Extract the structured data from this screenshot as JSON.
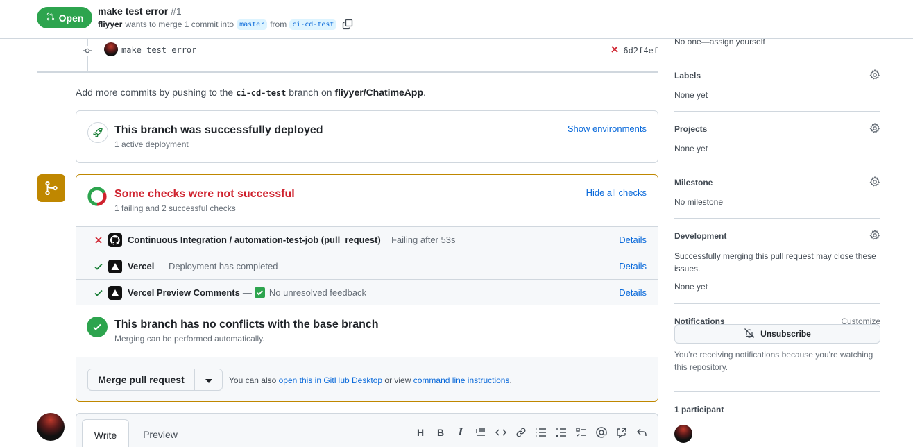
{
  "header": {
    "state": "Open",
    "title": "make test error",
    "number": "#1",
    "author": "fliyyer",
    "merge_text": "wants to merge 1 commit into",
    "base_branch": "master",
    "from_text": "from",
    "head_branch": "ci-cd-test"
  },
  "commit": {
    "message": "make test error",
    "sha": "6d2f4ef"
  },
  "add_commits": {
    "prefix": "Add more commits by pushing to the",
    "branch": "ci-cd-test",
    "middle": "branch on",
    "repo": "fliyyer/ChatimeApp",
    "suffix": "."
  },
  "deploy": {
    "title": "This branch was successfully deployed",
    "subtitle": "1 active deployment",
    "link": "Show environments"
  },
  "checks": {
    "title": "Some checks were not successful",
    "subtitle": "1 failing and 2 successful checks",
    "link": "Hide all checks",
    "items": [
      {
        "name": "Continuous Integration / automation-test-job (pull_request)",
        "desc": "Failing after 53s",
        "details": "Details",
        "status": "fail"
      },
      {
        "name": "Vercel",
        "desc": "— Deployment has completed",
        "details": "Details",
        "status": "success"
      },
      {
        "name": "Vercel Preview Comments",
        "desc_prefix": "—",
        "desc": "No unresolved feedback",
        "details": "Details",
        "status": "success"
      }
    ]
  },
  "conflicts": {
    "title": "This branch has no conflicts with the base branch",
    "subtitle": "Merging can be performed automatically."
  },
  "merge": {
    "button": "Merge pull request",
    "alt_prefix": "You can also",
    "alt_link1": "open this in GitHub Desktop",
    "alt_middle": "or view",
    "alt_link2": "command line instructions",
    "alt_suffix": "."
  },
  "comment": {
    "tab_write": "Write",
    "tab_preview": "Preview"
  },
  "sidebar": {
    "assignees_value": "No one—assign yourself",
    "labels": {
      "title": "Labels",
      "value": "None yet"
    },
    "projects": {
      "title": "Projects",
      "value": "None yet"
    },
    "milestone": {
      "title": "Milestone",
      "value": "No milestone"
    },
    "development": {
      "title": "Development",
      "desc": "Successfully merging this pull request may close these issues.",
      "value": "None yet"
    },
    "notifications": {
      "title": "Notifications",
      "customize": "Customize",
      "button": "Unsubscribe",
      "note": "You're receiving notifications because you're watching this repository."
    },
    "participants": {
      "title": "1 participant"
    }
  },
  "colors": {
    "open_green": "#2da44e",
    "warning_gold": "#bf8700",
    "danger_red": "#cf222e",
    "link_blue": "#0969da"
  }
}
